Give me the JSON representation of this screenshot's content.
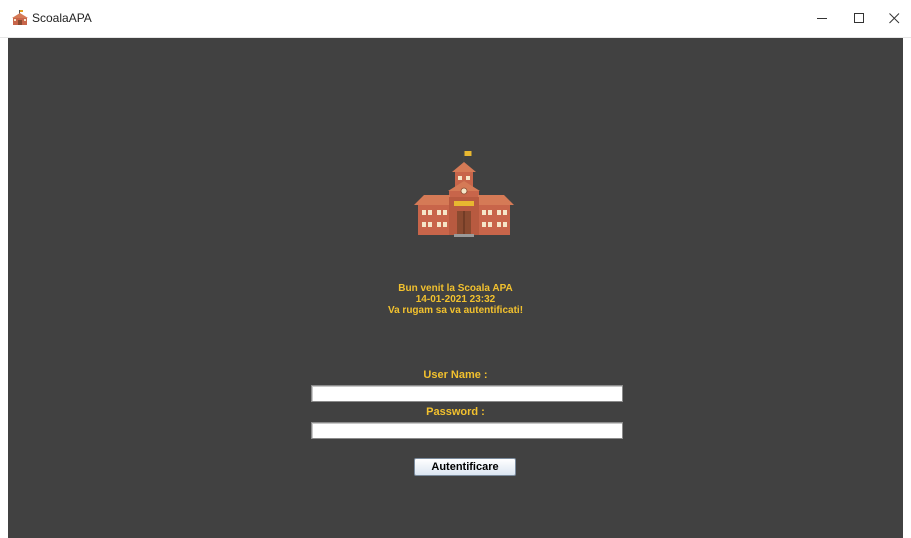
{
  "window": {
    "title": "ScoalaAPA",
    "icons": {
      "app": "school-icon",
      "minimize": "minimize-icon",
      "maximize": "maximize-icon",
      "close": "close-icon"
    }
  },
  "welcome": {
    "line1": "Bun venit la Scoala APA",
    "line2": "14-01-2021 23:32",
    "line3": "Va rugam sa va autentificati!"
  },
  "login": {
    "username_label": "User Name :",
    "username_value": "",
    "password_label": "Password :",
    "password_value": "",
    "submit_label": "Autentificare"
  },
  "colors": {
    "background": "#414141",
    "accent_text": "#f2c12e",
    "school_wall": "#c8654a",
    "school_roof": "#d57a56"
  }
}
